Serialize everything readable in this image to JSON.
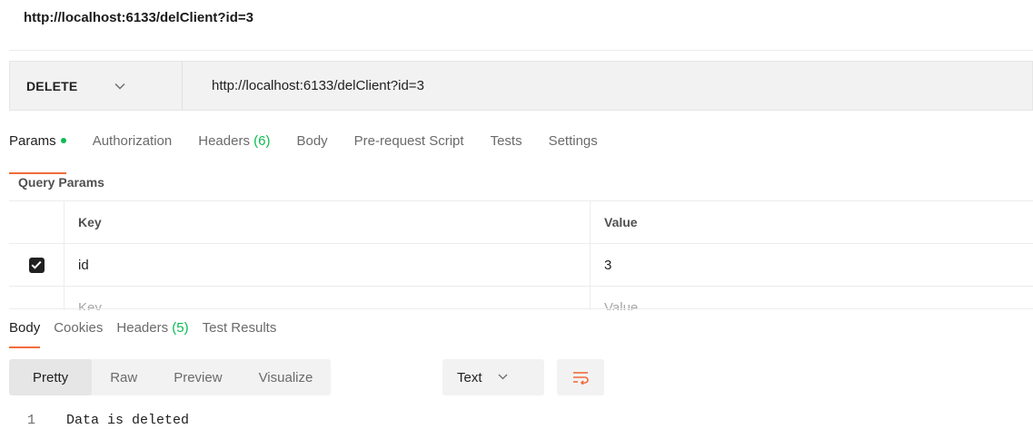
{
  "request": {
    "title": "http://localhost:6133/delClient?id=3",
    "method": "DELETE",
    "url": "http://localhost:6133/delClient?id=3"
  },
  "request_tabs": {
    "params": "Params",
    "authorization": "Authorization",
    "headers": "Headers",
    "headers_count": "(6)",
    "body": "Body",
    "pre_request_script": "Pre-request Script",
    "tests": "Tests",
    "settings": "Settings"
  },
  "query_params": {
    "label": "Query Params",
    "columns": {
      "key": "Key",
      "value": "Value"
    },
    "rows": [
      {
        "key": "id",
        "value": "3",
        "checked": true
      }
    ],
    "placeholder": {
      "key": "Key",
      "value": "Value"
    }
  },
  "response_tabs": {
    "body": "Body",
    "cookies": "Cookies",
    "headers": "Headers",
    "headers_count": "(5)",
    "test_results": "Test Results"
  },
  "view_modes": {
    "pretty": "Pretty",
    "raw": "Raw",
    "preview": "Preview",
    "visualize": "Visualize"
  },
  "format": {
    "selected": "Text"
  },
  "response_body": {
    "lines": [
      {
        "number": "1",
        "text": "Data is deleted"
      }
    ]
  },
  "icons": {
    "method_chevron": "chevron-down-icon",
    "format_chevron": "chevron-down-icon",
    "wrap": "wrap-lines-icon",
    "checkbox": "checkmark-icon"
  },
  "colors": {
    "accent": "#f26b3a",
    "status_green": "#0cbb52"
  }
}
